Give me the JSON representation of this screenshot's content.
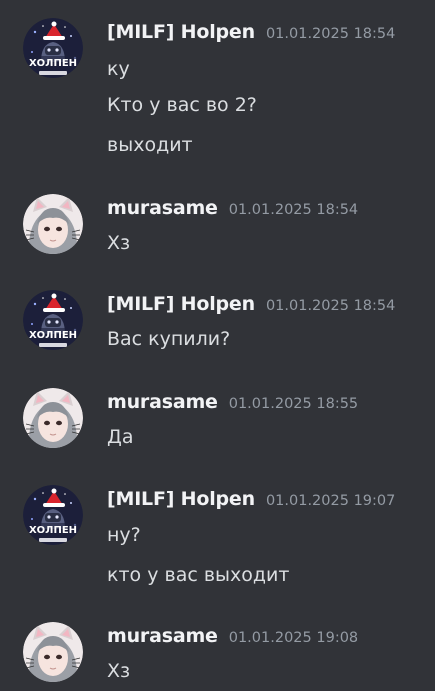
{
  "messages": [
    {
      "author": "[MILF] Holpen",
      "avatar_icon": "holpen-avatar-icon",
      "timestamp": "01.01.2025 18:54",
      "lines": [
        "ку",
        "Кто у вас во 2?",
        "выходит"
      ]
    },
    {
      "author": "murasame",
      "avatar_icon": "murasame-avatar-icon",
      "timestamp": "01.01.2025 18:54",
      "lines": [
        "Хз"
      ]
    },
    {
      "author": "[MILF] Holpen",
      "avatar_icon": "holpen-avatar-icon",
      "timestamp": "01.01.2025 18:54",
      "lines": [
        "Вас купили?"
      ]
    },
    {
      "author": "murasame",
      "avatar_icon": "murasame-avatar-icon",
      "timestamp": "01.01.2025 18:55",
      "lines": [
        "Да"
      ]
    },
    {
      "author": "[MILF] Holpen",
      "avatar_icon": "holpen-avatar-icon",
      "timestamp": "01.01.2025 19:07",
      "lines": [
        "ну?",
        "кто у вас выходит"
      ]
    },
    {
      "author": "murasame",
      "avatar_icon": "murasame-avatar-icon",
      "timestamp": "01.01.2025 19:08",
      "lines": [
        "Хз"
      ]
    }
  ],
  "holpen_avatar_text": "ХОЛПЕН",
  "colors": {
    "background": "#313338",
    "username": "#f2f3f5",
    "timestamp": "#949ba4",
    "message_text": "#dbdee1"
  }
}
